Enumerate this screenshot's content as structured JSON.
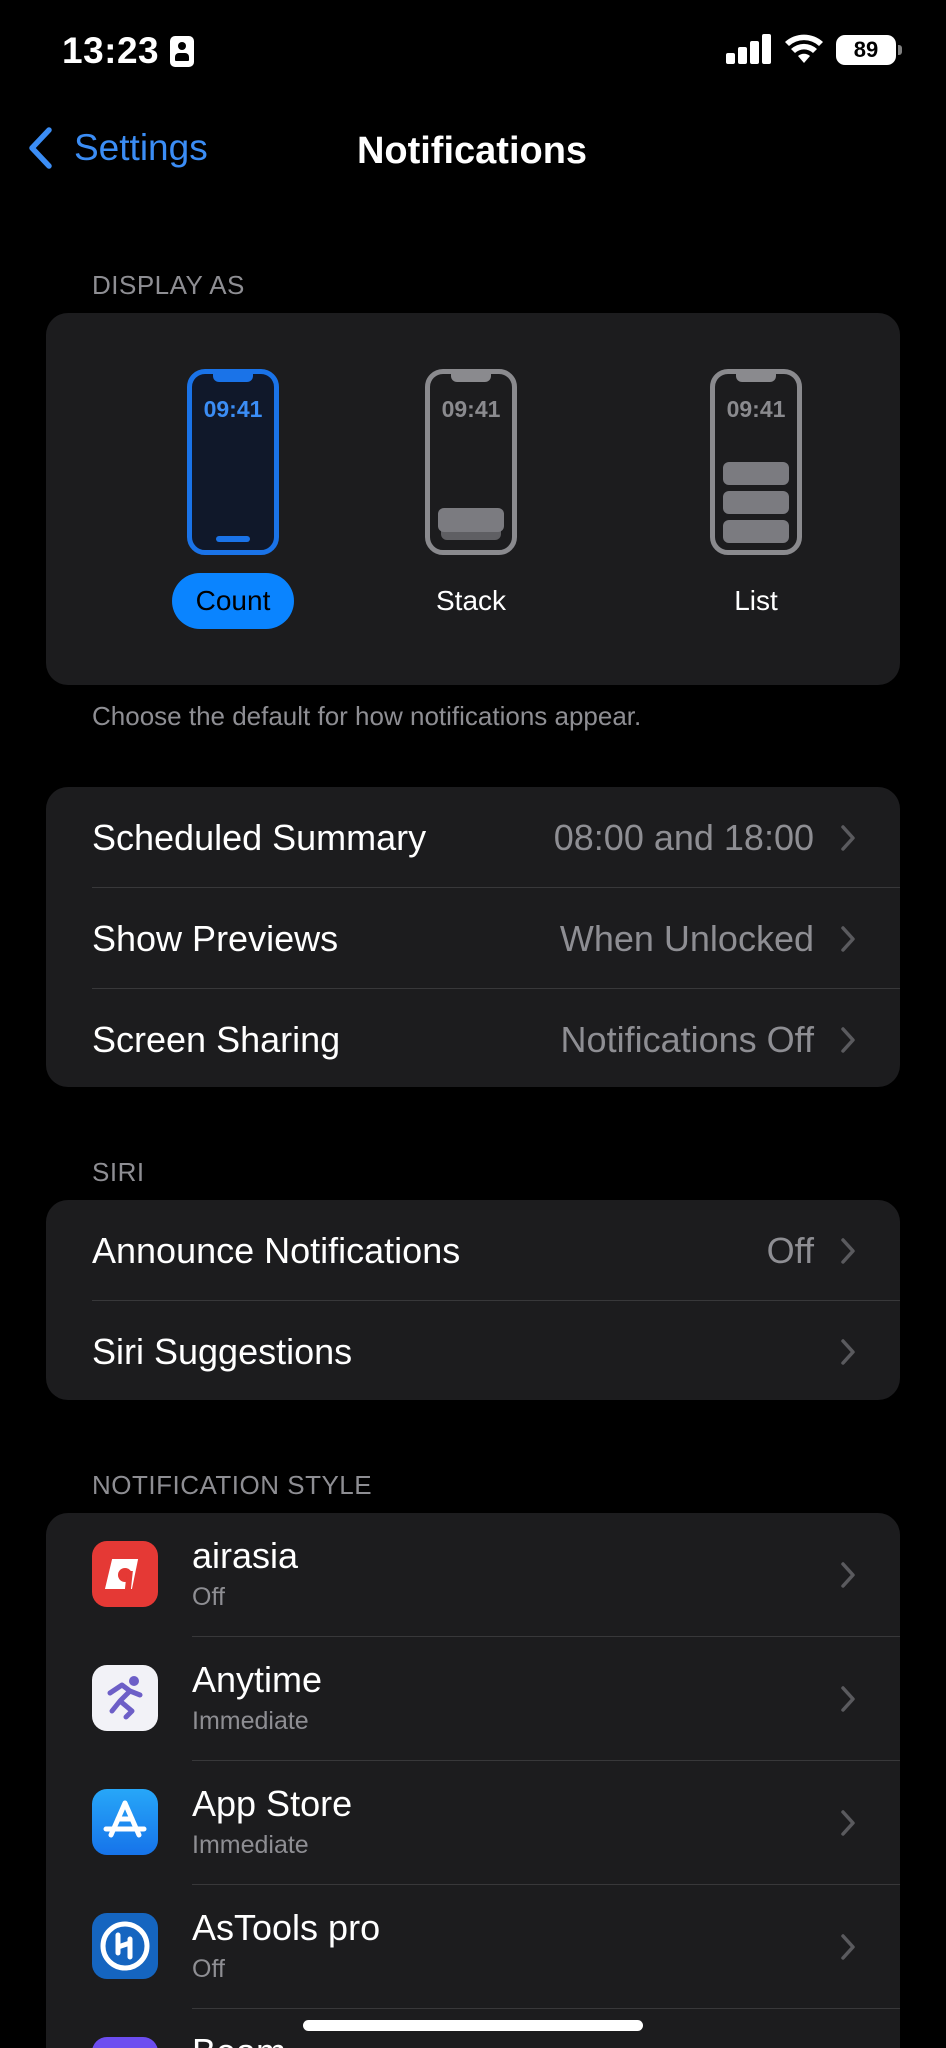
{
  "status": {
    "time": "13:23",
    "battery": "89"
  },
  "nav": {
    "back_label": "Settings",
    "title": "Notifications"
  },
  "display_as": {
    "header": "DISPLAY AS",
    "phone_time": "09:41",
    "options": [
      {
        "label": "Count",
        "selected": true
      },
      {
        "label": "Stack",
        "selected": false
      },
      {
        "label": "List",
        "selected": false
      }
    ],
    "footer": "Choose the default for how notifications appear."
  },
  "general_rows": [
    {
      "label": "Scheduled Summary",
      "value": "08:00 and 18:00"
    },
    {
      "label": "Show Previews",
      "value": "When Unlocked"
    },
    {
      "label": "Screen Sharing",
      "value": "Notifications Off"
    }
  ],
  "siri": {
    "header": "SIRI",
    "rows": [
      {
        "label": "Announce Notifications",
        "value": "Off"
      },
      {
        "label": "Siri Suggestions",
        "value": ""
      }
    ]
  },
  "notification_style": {
    "header": "NOTIFICATION STYLE",
    "apps": [
      {
        "name": "airasia",
        "status": "Off",
        "icon": "airasia-icon",
        "color": "#e53935"
      },
      {
        "name": "Anytime",
        "status": "Immediate",
        "icon": "anytime-icon",
        "color": "#f2f2f7"
      },
      {
        "name": "App Store",
        "status": "Immediate",
        "icon": "app-store-icon",
        "color": "#1e88f5"
      },
      {
        "name": "AsTools pro",
        "status": "Off",
        "icon": "astools-icon",
        "color": "#1565c0"
      },
      {
        "name": "Beam",
        "status": "",
        "icon": "beam-icon",
        "color": "#6c4df0"
      }
    ]
  },
  "colors": {
    "accent": "#0a84ff",
    "card": "#1c1c1e",
    "secondary_text": "#8e8e93"
  }
}
